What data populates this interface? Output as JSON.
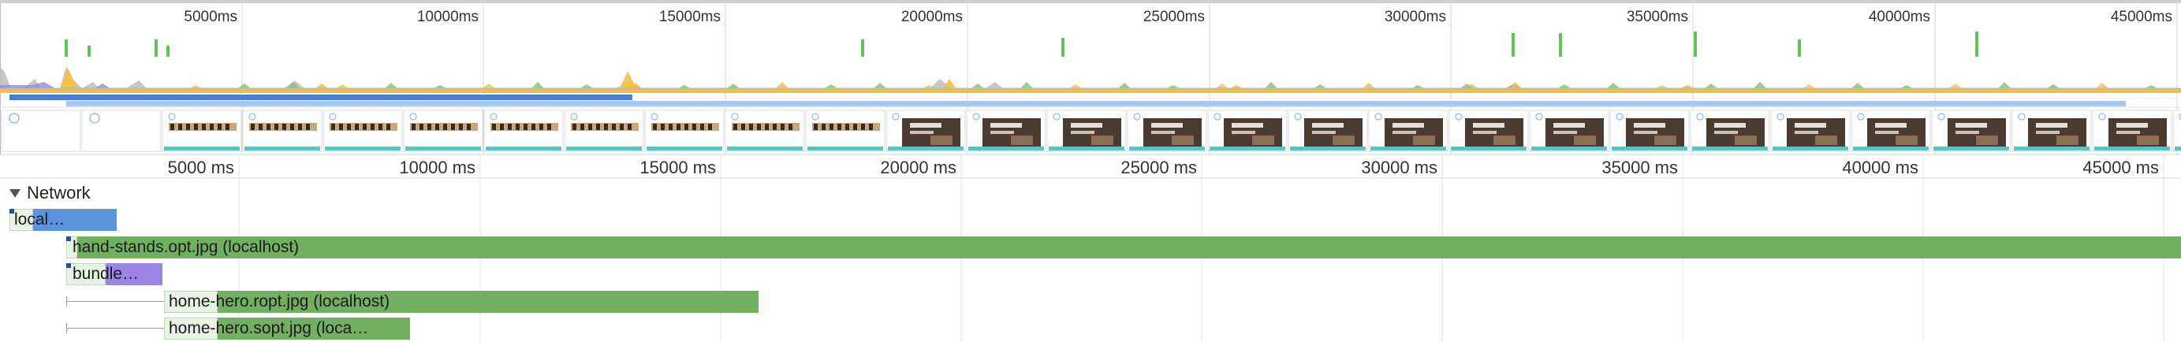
{
  "overview": {
    "tick_labels": [
      "5000ms",
      "10000ms",
      "15000ms",
      "20000ms",
      "25000ms",
      "30000ms",
      "35000ms",
      "40000ms",
      "45000ms"
    ],
    "colors": {
      "fps": "#5fc15f",
      "scripting": "#f4c241",
      "rendering": "#9b8ee0",
      "painting": "#7dc36b",
      "other": "#bdbdbd",
      "network_bar": "#4a7fd6",
      "network_bar_light": "#a9c6ee"
    },
    "frame_thumbnails": [
      {
        "kind": "blank"
      },
      {
        "kind": "blank"
      },
      {
        "kind": "striped"
      },
      {
        "kind": "striped"
      },
      {
        "kind": "striped"
      },
      {
        "kind": "striped"
      },
      {
        "kind": "striped"
      },
      {
        "kind": "striped"
      },
      {
        "kind": "striped"
      },
      {
        "kind": "striped"
      },
      {
        "kind": "striped"
      },
      {
        "kind": "photo"
      },
      {
        "kind": "photo"
      },
      {
        "kind": "photo"
      },
      {
        "kind": "photo"
      },
      {
        "kind": "photo"
      },
      {
        "kind": "photo"
      },
      {
        "kind": "photo"
      },
      {
        "kind": "photo"
      },
      {
        "kind": "photo"
      },
      {
        "kind": "photo"
      },
      {
        "kind": "photo"
      },
      {
        "kind": "photo"
      },
      {
        "kind": "photo"
      },
      {
        "kind": "photo"
      },
      {
        "kind": "photo"
      },
      {
        "kind": "photo"
      },
      {
        "kind": "photo"
      }
    ]
  },
  "main": {
    "tick_labels": [
      "5000 ms",
      "10000 ms",
      "15000 ms",
      "20000 ms",
      "25000 ms",
      "30000 ms",
      "35000 ms",
      "40000 ms",
      "45000 ms"
    ],
    "network_label": "Network",
    "requests": [
      {
        "label": "local…",
        "color": "#5b93dc"
      },
      {
        "label": "hand-stands.opt.jpg (localhost)",
        "color": "#72b061"
      },
      {
        "label": "bundle…",
        "color": "#9a85e4"
      },
      {
        "label": "home-hero.ropt.jpg (localhost)",
        "color": "#72b061"
      },
      {
        "label": "home-hero.sopt.jpg (loca…",
        "color": "#72b061"
      }
    ]
  }
}
